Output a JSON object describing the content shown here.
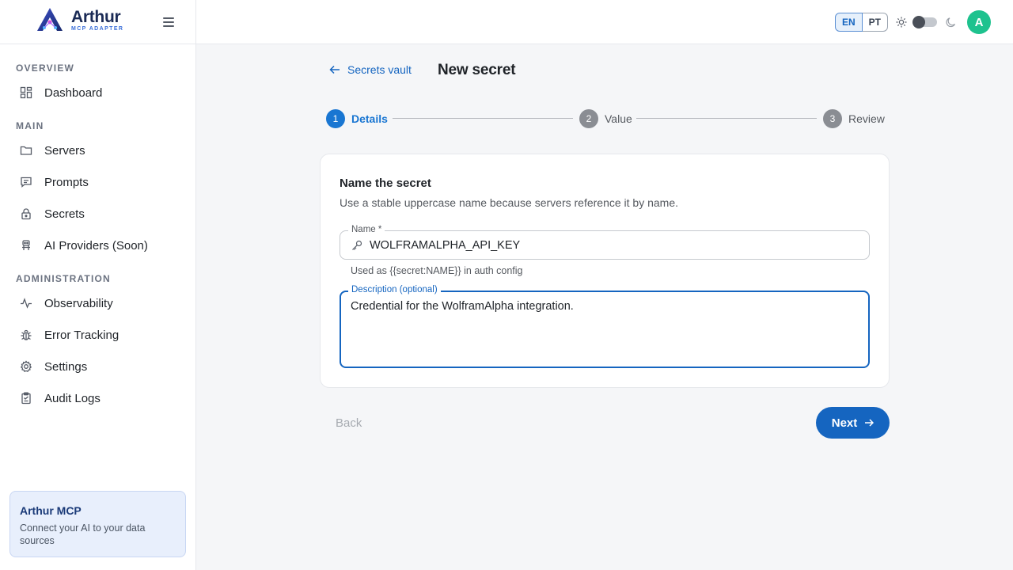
{
  "app": {
    "name": "Arthur",
    "tagline": "MCP ADAPTER"
  },
  "sidebar": {
    "sections": {
      "overview": "OVERVIEW",
      "main": "MAIN",
      "administration": "ADMINISTRATION"
    },
    "items": [
      {
        "label": "Dashboard",
        "icon": "dashboard-icon"
      },
      {
        "label": "Servers",
        "icon": "folder-icon"
      },
      {
        "label": "Prompts",
        "icon": "message-icon"
      },
      {
        "label": "Secrets",
        "icon": "lock-icon"
      },
      {
        "label": "AI Providers (Soon)",
        "icon": "robot-icon"
      },
      {
        "label": "Observability",
        "icon": "activity-icon"
      },
      {
        "label": "Error Tracking",
        "icon": "bug-icon"
      },
      {
        "label": "Settings",
        "icon": "gear-icon"
      },
      {
        "label": "Audit Logs",
        "icon": "clipboard-icon"
      }
    ],
    "promo": {
      "title": "Arthur MCP",
      "text": "Connect your AI to your data sources"
    }
  },
  "topbar": {
    "languages": [
      "EN",
      "PT"
    ],
    "selected_language": "EN",
    "avatar_initial": "A"
  },
  "page": {
    "back_link": "Secrets vault",
    "title": "New secret"
  },
  "stepper": {
    "steps": [
      {
        "number": "1",
        "label": "Details",
        "state": "active"
      },
      {
        "number": "2",
        "label": "Value",
        "state": "idle"
      },
      {
        "number": "3",
        "label": "Review",
        "state": "idle"
      }
    ]
  },
  "form": {
    "title": "Name the secret",
    "subtitle": "Use a stable uppercase name because servers reference it by name.",
    "name_label": "Name *",
    "name_value": "WOLFRAMALPHA_API_KEY",
    "name_helper": "Used as {{secret:NAME}} in auth config",
    "description_label": "Description (optional)",
    "description_value": "Credential for the WolframAlpha integration."
  },
  "actions": {
    "back": "Back",
    "next": "Next"
  },
  "colors": {
    "accent": "#1565c0",
    "avatar": "#1ec28e",
    "promo_bg": "#e8effc"
  }
}
